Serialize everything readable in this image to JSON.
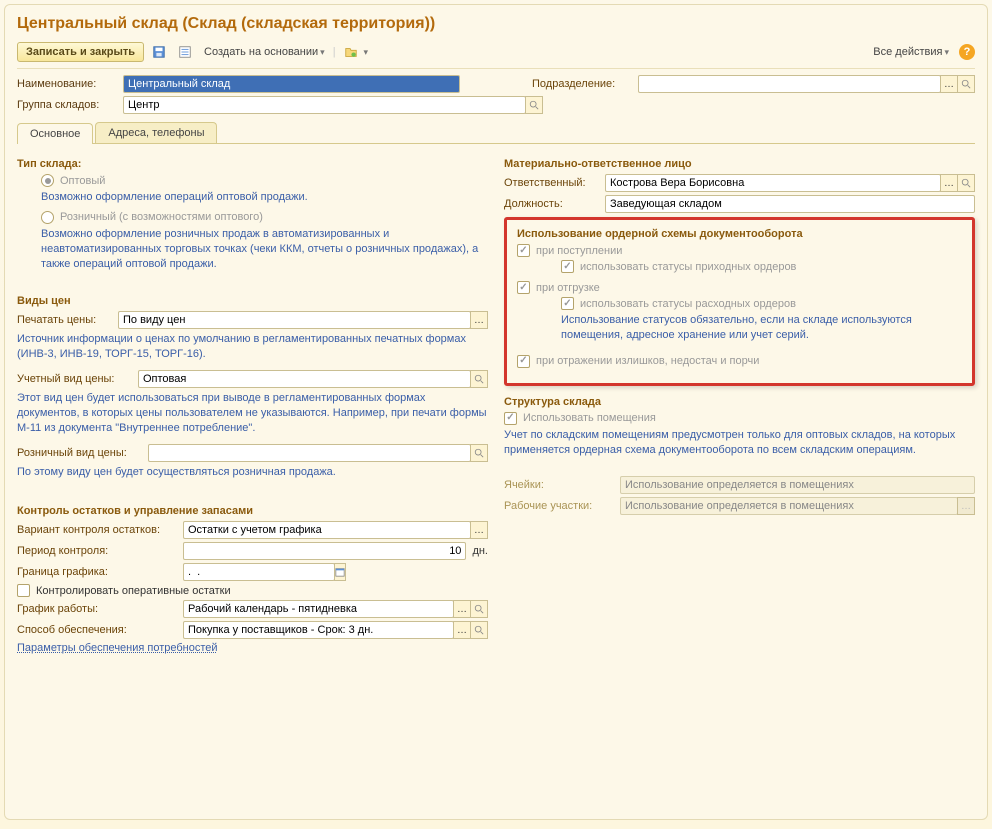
{
  "title": "Центральный склад (Склад (складская территория))",
  "toolbar": {
    "save_close": "Записать и закрыть",
    "create_based_on": "Создать на основании",
    "all_actions": "Все действия"
  },
  "header": {
    "name_label": "Наименование:",
    "name_value": "Центральный склад",
    "subdiv_label": "Подразделение:",
    "subdiv_value": "",
    "group_label": "Группа складов:",
    "group_value": "Центр"
  },
  "tabs": {
    "main": "Основное",
    "addresses": "Адреса, телефоны"
  },
  "left": {
    "type_h": "Тип склада:",
    "radio_wholesale": "Оптовый",
    "hint_wholesale": "Возможно оформление операций оптовой продажи.",
    "radio_retail": "Розничный (с возможностями оптового)",
    "hint_retail": "Возможно оформление розничных продаж в автоматизированных и неавтоматизированных торговых точках (чеки ККМ, отчеты о розничных продажах), а также операций оптовой продажи.",
    "prices_h": "Виды цен",
    "print_prices_label": "Печатать цены:",
    "print_prices_value": "По виду цен",
    "print_prices_hint": "Источник информации о ценах по умолчанию в регламентированных печатных формах (ИНВ-3, ИНВ-19, ТОРГ-15, ТОРГ-16).",
    "acct_price_label": "Учетный вид цены:",
    "acct_price_value": "Оптовая",
    "acct_price_hint": "Этот вид цен будет использоваться при выводе в регламентированных формах документов, в которых цены пользователем не указываются. Например, при печати формы М-11 из документа \"Внутреннее потребление\".",
    "retail_price_label": "Розничный вид цены:",
    "retail_price_value": "",
    "retail_price_hint": "По этому виду цен будет осуществляться розничная продажа.",
    "stock_h": "Контроль остатков и управление запасами",
    "variant_label": "Вариант контроля остатков:",
    "variant_value": "Остатки с учетом графика",
    "period_label": "Период контроля:",
    "period_value": "10",
    "period_unit": "дн.",
    "boundary_label": "Граница графика:",
    "boundary_value": ".  .",
    "control_op": "Контролировать оперативные остатки",
    "schedule_label": "График работы:",
    "schedule_value": "Рабочий календарь - пятидневка",
    "supply_label": "Способ обеспечения:",
    "supply_value": "Покупка у поставщиков - Срок: 3 дн.",
    "params_link": "Параметры обеспечения потребностей"
  },
  "right": {
    "mol_h": "Материально-ответственное лицо",
    "resp_label": "Ответственный:",
    "resp_value": "Кострова Вера Борисовна",
    "pos_label": "Должность:",
    "pos_value": "Заведующая складом",
    "order_h": "Использование ордерной схемы документооборота",
    "chk_incoming": "при поступлении",
    "chk_incoming_status": "использовать статусы приходных ордеров",
    "chk_shipping": "при отгрузке",
    "chk_shipping_status": "использовать статусы расходных ордеров",
    "status_hint": "Использование статусов обязательно, если на складе используются помещения, адресное хранение или учет серий.",
    "chk_surplus": "при отражении излишков, недостач и порчи",
    "struct_h": "Структура склада",
    "chk_rooms": "Использовать помещения",
    "rooms_hint": "Учет по складским помещениям предусмотрен только для оптовых складов, на которых применяется ордерная схема документооборота по всем складским операциям.",
    "cells_label": "Ячейки:",
    "cells_value": "Использование определяется в помещениях",
    "areas_label": "Рабочие участки:",
    "areas_value": "Использование определяется в помещениях"
  }
}
